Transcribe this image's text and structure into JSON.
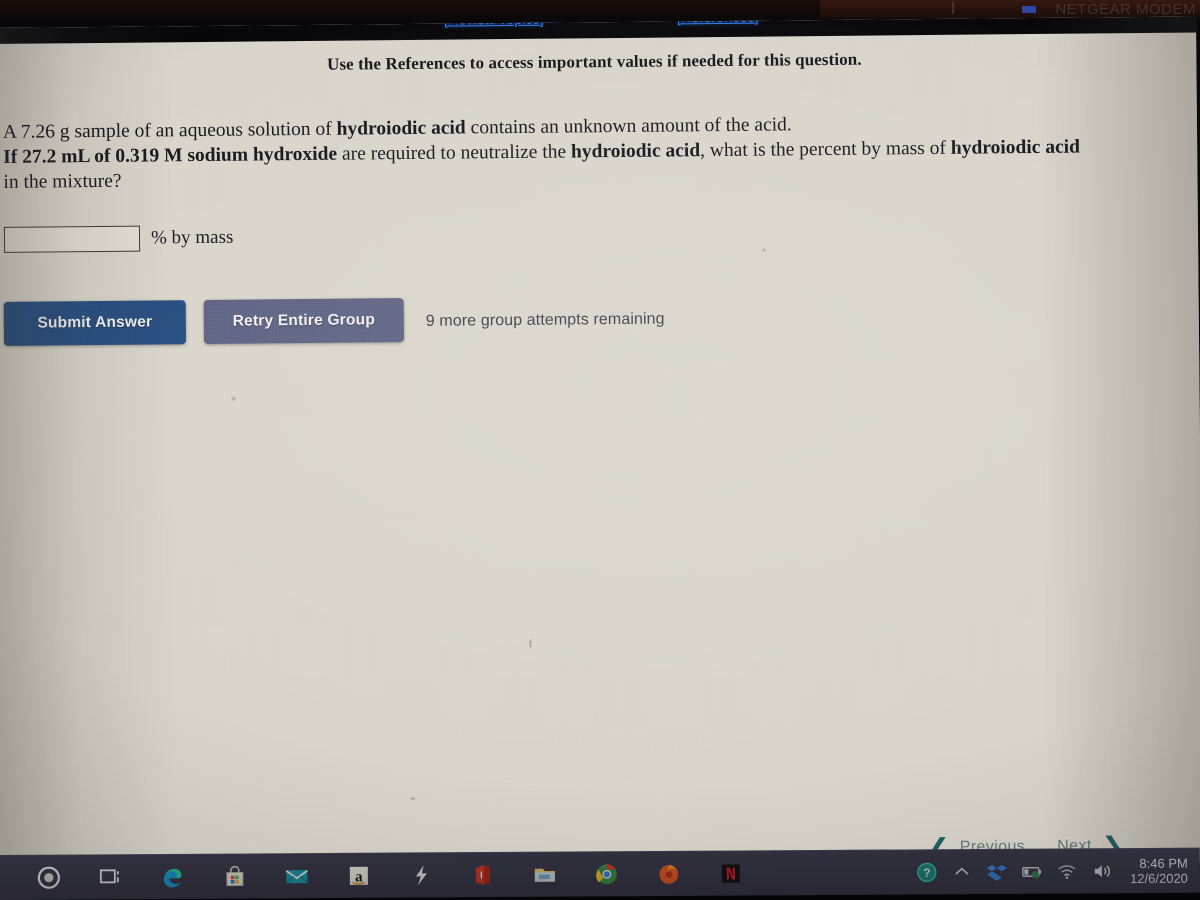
{
  "bezel": {
    "faint_text": "NETGEAR MODEM"
  },
  "browser_nav": {
    "review_topics": "[Review Topics]",
    "references": "[References]",
    "link_color": "#2f7ffb"
  },
  "page": {
    "reference_note": "Use the References to access important values if needed for this question.",
    "question_parts": [
      {
        "text": "A 7.26 g sample of an aqueous solution of ",
        "bold": false
      },
      {
        "text": "hydroiodic acid",
        "bold": true
      },
      {
        "text": " contains an unknown amount of the acid.",
        "bold": false
      },
      {
        "text": "\n",
        "bold": false
      },
      {
        "text": "If 27.2 mL of 0.319 M sodium hydroxide",
        "bold": true
      },
      {
        "text": " are required to neutralize the ",
        "bold": false
      },
      {
        "text": "hydroiodic acid",
        "bold": true
      },
      {
        "text": ", what is the percent by mass of ",
        "bold": false
      },
      {
        "text": "hydroiodic acid",
        "bold": true
      },
      {
        "text": "\nin the mixture?",
        "bold": false
      }
    ],
    "question_line1_plain_a": "A ",
    "question_values": {
      "sample_mass": "7.26 g",
      "acid_name": "hydroiodic acid",
      "titrant_volume": "27.2 mL",
      "titrant_concentration": "0.319 M",
      "titrant_name": "sodium hydroxide"
    },
    "answer_input": {
      "value": "",
      "placeholder": ""
    },
    "unit_label": "% by mass",
    "submit_label": "Submit Answer",
    "retry_label": "Retry Entire Group",
    "attempts_text": "9 more group attempts remaining",
    "submit_color": "#21497d",
    "retry_color": "#5b6081"
  },
  "pager": {
    "previous_label": "Previous",
    "next_label": "Next",
    "prev_chevron": "❮",
    "next_chevron": "❯",
    "color": "#41696d"
  },
  "taskbar": {
    "items": [
      {
        "name": "cortana-icon",
        "label": "Cortana"
      },
      {
        "name": "task-view-icon",
        "label": "Task View"
      },
      {
        "name": "edge-browser-icon",
        "label": "Microsoft Edge"
      },
      {
        "name": "microsoft-store-icon",
        "label": "Microsoft Store"
      },
      {
        "name": "mail-icon",
        "label": "Mail"
      },
      {
        "name": "amazon-icon",
        "label": "Amazon"
      },
      {
        "name": "lightning-icon",
        "label": "Lightning"
      },
      {
        "name": "office-icon",
        "label": "Office"
      },
      {
        "name": "file-explorer-icon",
        "label": "File Explorer"
      },
      {
        "name": "chrome-browser-icon",
        "label": "Google Chrome"
      },
      {
        "name": "firefox-browser-icon",
        "label": "Mozilla Firefox"
      },
      {
        "name": "netflix-icon",
        "label": "Netflix"
      }
    ],
    "tray": [
      {
        "name": "help-question-icon",
        "label": "Help"
      },
      {
        "name": "show-hidden-icons-chevron-icon",
        "label": "Show hidden icons"
      },
      {
        "name": "dropbox-icon",
        "label": "Dropbox"
      },
      {
        "name": "battery-icon",
        "label": "Battery"
      },
      {
        "name": "wifi-icon",
        "label": "Network"
      },
      {
        "name": "volume-icon",
        "label": "Volume"
      }
    ],
    "clock_time": "8:46 PM",
    "clock_date": "12/6/2020",
    "background": "#3b3a4b"
  }
}
